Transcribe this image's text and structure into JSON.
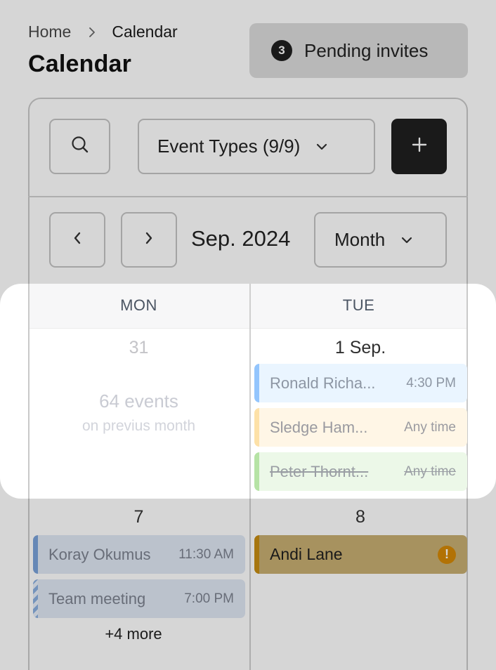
{
  "breadcrumb": {
    "home": "Home",
    "current": "Calendar"
  },
  "page": {
    "title": "Calendar"
  },
  "pending": {
    "count": "3",
    "label": "Pending invites"
  },
  "toolbar": {
    "event_types_label": "Event Types (9/9)"
  },
  "nav": {
    "month_label": "Sep. 2024",
    "view_label": "Month"
  },
  "grid": {
    "headers": [
      "MON",
      "TUE"
    ],
    "dates": {
      "d31": "31",
      "d1": "1 Sep.",
      "d7": "7",
      "d8": "8"
    },
    "previous_month": {
      "count": "64 events",
      "note": "on previus month"
    },
    "events": {
      "ronald": {
        "name": "Ronald Richa...",
        "time": "4:30 PM"
      },
      "sledge": {
        "name": "Sledge Ham...",
        "time": "Any time"
      },
      "peter": {
        "name": "Peter Thornt...",
        "time": "Any time"
      },
      "koray": {
        "name": "Koray Okumus",
        "time": "11:30 AM"
      },
      "team": {
        "name": "Team meeting",
        "time": "7:00 PM"
      },
      "andi": {
        "name": "Andi Lane"
      }
    },
    "more_label": "+4 more"
  }
}
